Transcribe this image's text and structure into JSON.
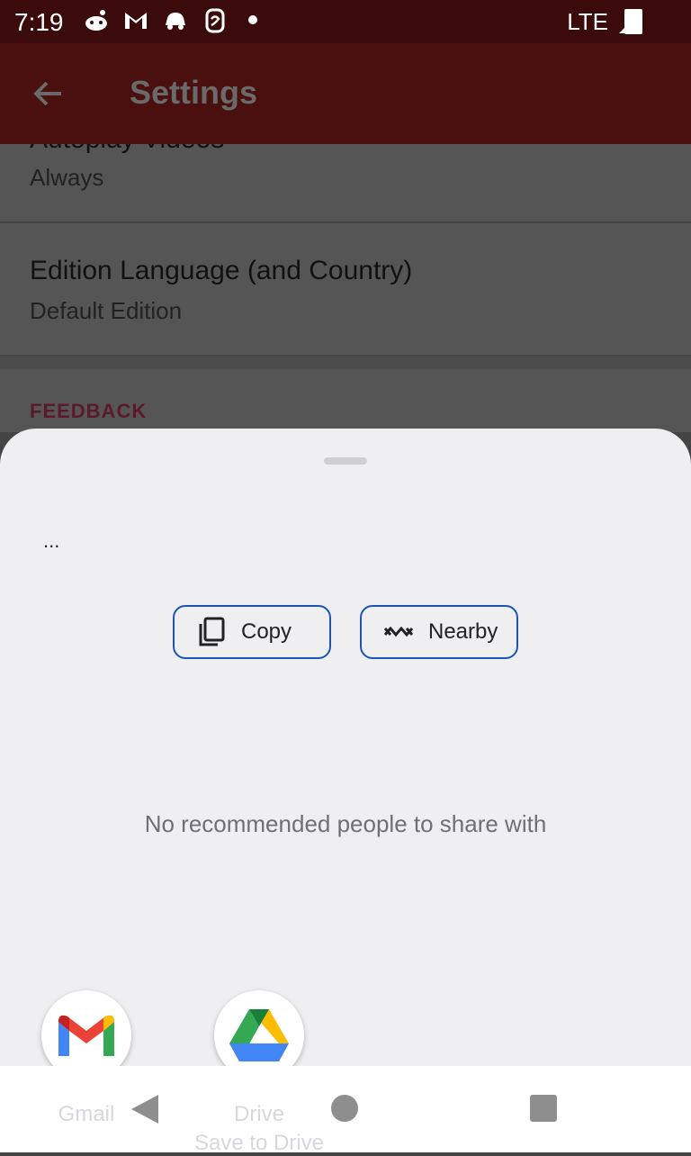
{
  "status_bar": {
    "time": "7:19",
    "network": "LTE",
    "notification_icons": [
      "reddit-icon",
      "gmail-icon",
      "car-icon",
      "scribd-icon",
      "dot-icon"
    ]
  },
  "app_bar": {
    "title": "Settings",
    "background": "#4a0f0f"
  },
  "settings": {
    "items": [
      {
        "title": "Autoplay Videos",
        "subtitle": "Always"
      },
      {
        "title": "Edition Language (and Country)",
        "subtitle": "Default Edition"
      }
    ],
    "section_header": "FEEDBACK"
  },
  "share_sheet": {
    "preview_text": "...",
    "actions": [
      {
        "label": "Copy",
        "icon": "copy-icon"
      },
      {
        "label": "Nearby",
        "icon": "nearby-icon"
      }
    ],
    "empty_message": "No recommended people to share with",
    "apps": [
      {
        "label": "Gmail",
        "sublabel": "",
        "icon": "gmail-icon"
      },
      {
        "label": "Drive",
        "sublabel": "Save to Drive",
        "icon": "drive-icon"
      }
    ],
    "accent": "#1a55b5"
  },
  "nav_bar": {
    "buttons": [
      "back",
      "home",
      "recents"
    ]
  }
}
